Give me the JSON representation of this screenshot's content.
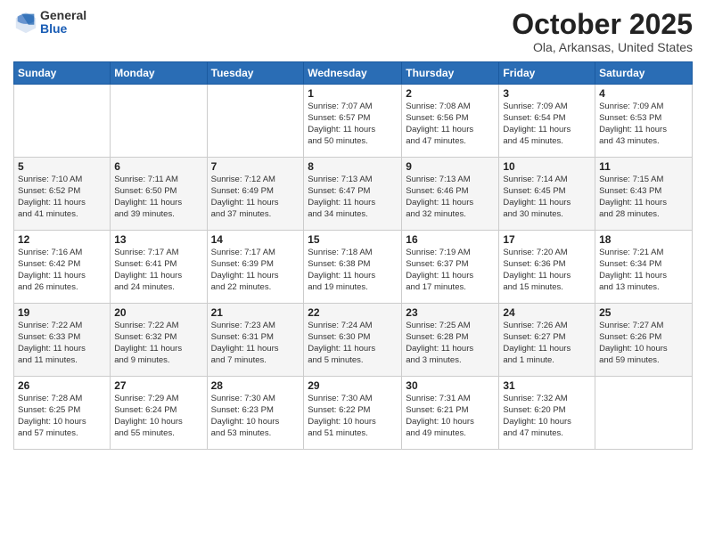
{
  "header": {
    "logo": {
      "general": "General",
      "blue": "Blue"
    },
    "title": "October 2025",
    "subtitle": "Ola, Arkansas, United States"
  },
  "days_of_week": [
    "Sunday",
    "Monday",
    "Tuesday",
    "Wednesday",
    "Thursday",
    "Friday",
    "Saturday"
  ],
  "weeks": [
    [
      {
        "day": "",
        "info": ""
      },
      {
        "day": "",
        "info": ""
      },
      {
        "day": "",
        "info": ""
      },
      {
        "day": "1",
        "info": "Sunrise: 7:07 AM\nSunset: 6:57 PM\nDaylight: 11 hours\nand 50 minutes."
      },
      {
        "day": "2",
        "info": "Sunrise: 7:08 AM\nSunset: 6:56 PM\nDaylight: 11 hours\nand 47 minutes."
      },
      {
        "day": "3",
        "info": "Sunrise: 7:09 AM\nSunset: 6:54 PM\nDaylight: 11 hours\nand 45 minutes."
      },
      {
        "day": "4",
        "info": "Sunrise: 7:09 AM\nSunset: 6:53 PM\nDaylight: 11 hours\nand 43 minutes."
      }
    ],
    [
      {
        "day": "5",
        "info": "Sunrise: 7:10 AM\nSunset: 6:52 PM\nDaylight: 11 hours\nand 41 minutes."
      },
      {
        "day": "6",
        "info": "Sunrise: 7:11 AM\nSunset: 6:50 PM\nDaylight: 11 hours\nand 39 minutes."
      },
      {
        "day": "7",
        "info": "Sunrise: 7:12 AM\nSunset: 6:49 PM\nDaylight: 11 hours\nand 37 minutes."
      },
      {
        "day": "8",
        "info": "Sunrise: 7:13 AM\nSunset: 6:47 PM\nDaylight: 11 hours\nand 34 minutes."
      },
      {
        "day": "9",
        "info": "Sunrise: 7:13 AM\nSunset: 6:46 PM\nDaylight: 11 hours\nand 32 minutes."
      },
      {
        "day": "10",
        "info": "Sunrise: 7:14 AM\nSunset: 6:45 PM\nDaylight: 11 hours\nand 30 minutes."
      },
      {
        "day": "11",
        "info": "Sunrise: 7:15 AM\nSunset: 6:43 PM\nDaylight: 11 hours\nand 28 minutes."
      }
    ],
    [
      {
        "day": "12",
        "info": "Sunrise: 7:16 AM\nSunset: 6:42 PM\nDaylight: 11 hours\nand 26 minutes."
      },
      {
        "day": "13",
        "info": "Sunrise: 7:17 AM\nSunset: 6:41 PM\nDaylight: 11 hours\nand 24 minutes."
      },
      {
        "day": "14",
        "info": "Sunrise: 7:17 AM\nSunset: 6:39 PM\nDaylight: 11 hours\nand 22 minutes."
      },
      {
        "day": "15",
        "info": "Sunrise: 7:18 AM\nSunset: 6:38 PM\nDaylight: 11 hours\nand 19 minutes."
      },
      {
        "day": "16",
        "info": "Sunrise: 7:19 AM\nSunset: 6:37 PM\nDaylight: 11 hours\nand 17 minutes."
      },
      {
        "day": "17",
        "info": "Sunrise: 7:20 AM\nSunset: 6:36 PM\nDaylight: 11 hours\nand 15 minutes."
      },
      {
        "day": "18",
        "info": "Sunrise: 7:21 AM\nSunset: 6:34 PM\nDaylight: 11 hours\nand 13 minutes."
      }
    ],
    [
      {
        "day": "19",
        "info": "Sunrise: 7:22 AM\nSunset: 6:33 PM\nDaylight: 11 hours\nand 11 minutes."
      },
      {
        "day": "20",
        "info": "Sunrise: 7:22 AM\nSunset: 6:32 PM\nDaylight: 11 hours\nand 9 minutes."
      },
      {
        "day": "21",
        "info": "Sunrise: 7:23 AM\nSunset: 6:31 PM\nDaylight: 11 hours\nand 7 minutes."
      },
      {
        "day": "22",
        "info": "Sunrise: 7:24 AM\nSunset: 6:30 PM\nDaylight: 11 hours\nand 5 minutes."
      },
      {
        "day": "23",
        "info": "Sunrise: 7:25 AM\nSunset: 6:28 PM\nDaylight: 11 hours\nand 3 minutes."
      },
      {
        "day": "24",
        "info": "Sunrise: 7:26 AM\nSunset: 6:27 PM\nDaylight: 11 hours\nand 1 minute."
      },
      {
        "day": "25",
        "info": "Sunrise: 7:27 AM\nSunset: 6:26 PM\nDaylight: 10 hours\nand 59 minutes."
      }
    ],
    [
      {
        "day": "26",
        "info": "Sunrise: 7:28 AM\nSunset: 6:25 PM\nDaylight: 10 hours\nand 57 minutes."
      },
      {
        "day": "27",
        "info": "Sunrise: 7:29 AM\nSunset: 6:24 PM\nDaylight: 10 hours\nand 55 minutes."
      },
      {
        "day": "28",
        "info": "Sunrise: 7:30 AM\nSunset: 6:23 PM\nDaylight: 10 hours\nand 53 minutes."
      },
      {
        "day": "29",
        "info": "Sunrise: 7:30 AM\nSunset: 6:22 PM\nDaylight: 10 hours\nand 51 minutes."
      },
      {
        "day": "30",
        "info": "Sunrise: 7:31 AM\nSunset: 6:21 PM\nDaylight: 10 hours\nand 49 minutes."
      },
      {
        "day": "31",
        "info": "Sunrise: 7:32 AM\nSunset: 6:20 PM\nDaylight: 10 hours\nand 47 minutes."
      },
      {
        "day": "",
        "info": ""
      }
    ]
  ]
}
